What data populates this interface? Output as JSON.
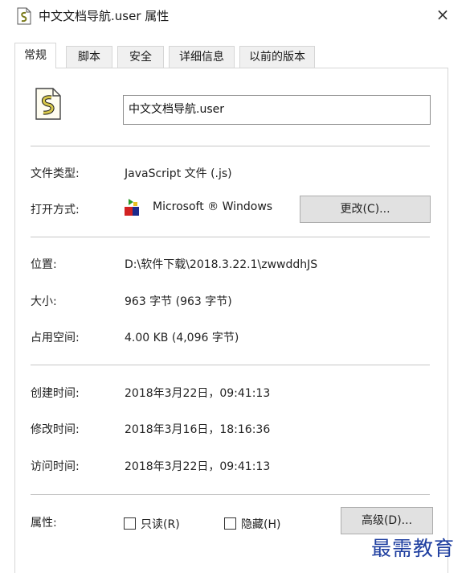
{
  "window": {
    "title": "中文文档导航.user 属性",
    "close_icon": "×"
  },
  "tabs": [
    {
      "label": "常规",
      "active": true
    },
    {
      "label": "脚本"
    },
    {
      "label": "安全"
    },
    {
      "label": "详细信息"
    },
    {
      "label": "以前的版本"
    }
  ],
  "file": {
    "icon": "script-file-icon",
    "name": "中文文档导航.user"
  },
  "type_section": {
    "file_type_label": "文件类型:",
    "file_type_value": "JavaScript 文件 (.js)",
    "open_with_label": "打开方式:",
    "open_with_app": "Microsoft ® Windows",
    "change_button": "更改(C)..."
  },
  "location_section": {
    "location_label": "位置:",
    "location_value": "D:\\软件下载\\2018.3.22.1\\zwwddhJS",
    "size_label": "大小:",
    "size_value": "963 字节 (963 字节)",
    "disk_label": "占用空间:",
    "disk_value": "4.00 KB (4,096 字节)"
  },
  "time_section": {
    "created_label": "创建时间:",
    "created_value": "2018年3月22日，09:41:13",
    "modified_label": "修改时间:",
    "modified_value": "2018年3月16日，18:16:36",
    "accessed_label": "访问时间:",
    "accessed_value": "2018年3月22日，09:41:13"
  },
  "attributes": {
    "label": "属性:",
    "readonly_label": "只读(R)",
    "readonly_checked": false,
    "hidden_label": "隐藏(H)",
    "hidden_checked": false,
    "advanced_button": "高级(D)..."
  },
  "watermark": "最需教育"
}
